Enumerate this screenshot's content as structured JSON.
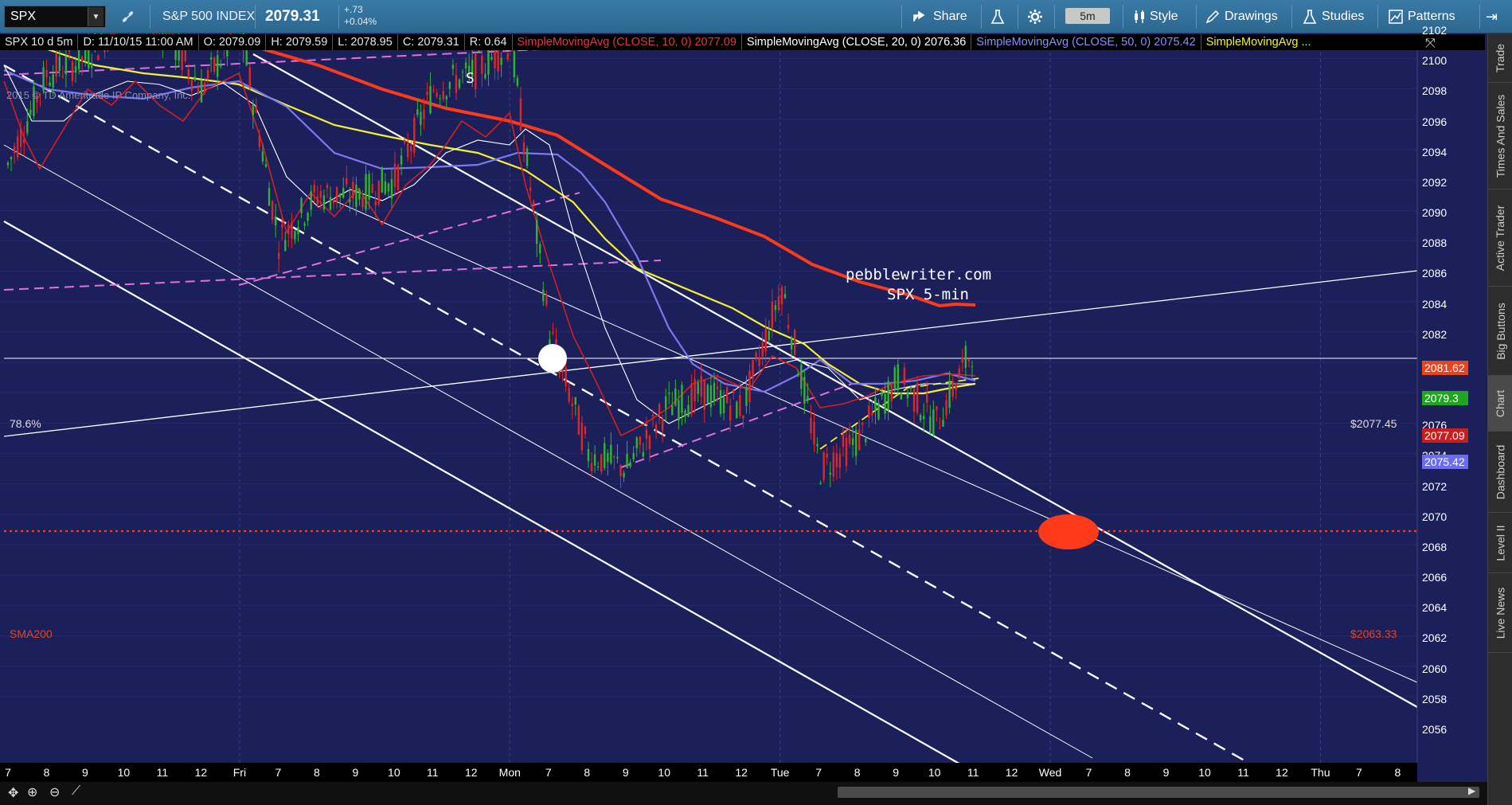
{
  "toolbar": {
    "symbol": "SPX",
    "instrument_name": "S&P 500 INDEX",
    "last_price": "2079.31",
    "change": "+.73",
    "change_pct": "+0.04%",
    "share_label": "Share",
    "timeframe": "5m",
    "style_label": "Style",
    "drawings_label": "Drawings",
    "studies_label": "Studies",
    "patterns_label": "Patterns"
  },
  "header": {
    "symbol_period": "SPX 10 d 5m",
    "date": "D: 11/10/15 11:00 AM",
    "open": "O: 2079.09",
    "high": "H: 2079.59",
    "low": "L: 2078.95",
    "close": "C: 2079.31",
    "range": "R: 0.64",
    "sma10_label": "SimpleMovingAvg (CLOSE, 10, 0)",
    "sma10_value": "2077.09",
    "sma20_label": "SimpleMovingAvg (CLOSE, 20, 0)",
    "sma20_value": "2076.36",
    "sma50_label": "SimpleMovingAvg (CLOSE, 50, 0)",
    "sma50_value": "2075.42",
    "sma100_label": "SimpleMovingAvg ..."
  },
  "chart_labels": {
    "copyright": "2015 © TD Ameritrade IP Company, Inc.",
    "marker_s": "S",
    "watermark_site": "pebblewriter.com",
    "watermark_desc": "SPX 5-min",
    "fib_label": "78.6%",
    "fib_price": "$2077.45",
    "sma200_label": "SMA200",
    "sma200_price": "$2063.33"
  },
  "price_badges": {
    "sma200": "2081.62",
    "last": "2079.3",
    "sma10": "2077.09",
    "sma50": "2075.42"
  },
  "colors": {
    "background": "#1b1f5a",
    "sma10": "#d42020",
    "sma20": "#ffffff",
    "sma50": "#7b78f0",
    "sma100": "#f2f230",
    "sma200": "#ff3a1a",
    "up_candle": "#2fb52f",
    "down_candle": "#e22626",
    "magenta_line": "#e070e0",
    "badge_green": "#1fa51f",
    "badge_red": "#c81e1e",
    "badge_blue": "#6c6cf2",
    "badge_orange": "#e8441e"
  },
  "chart_data": {
    "type": "candlestick",
    "title": "SPX 10 d 5m",
    "ylim": [
      2055,
      2103
    ],
    "y_ticks": [
      2056,
      2058,
      2060,
      2062,
      2064,
      2066,
      2068,
      2070,
      2072,
      2074,
      2076,
      2078,
      2080,
      2082,
      2084,
      2086,
      2088,
      2090,
      2092,
      2094,
      2096,
      2098,
      2100,
      2102
    ],
    "x_tick_labels": [
      "7",
      "8",
      "9",
      "10",
      "11",
      "12",
      "Fri",
      "7",
      "8",
      "9",
      "10",
      "11",
      "12",
      "Mon",
      "7",
      "8",
      "9",
      "10",
      "11",
      "12",
      "Tue",
      "7",
      "8",
      "9",
      "10",
      "11",
      "12",
      "Wed",
      "7",
      "8",
      "9",
      "10",
      "11",
      "12",
      "Thu",
      "7",
      "8"
    ],
    "close_path": [
      {
        "t": "Thu 7",
        "v": 2091
      },
      {
        "t": "Thu 8",
        "v": 2097
      },
      {
        "t": "Thu 9",
        "v": 2098
      },
      {
        "t": "Thu 10",
        "v": 2101
      },
      {
        "t": "Thu 11",
        "v": 2100
      },
      {
        "t": "Thu 12",
        "v": 2096
      },
      {
        "t": "Thu 1",
        "v": 2100
      },
      {
        "t": "Fri 7",
        "v": 2086
      },
      {
        "t": "Fri 8",
        "v": 2089
      },
      {
        "t": "Fri 9",
        "v": 2089
      },
      {
        "t": "Fri 10",
        "v": 2090
      },
      {
        "t": "Fri 11",
        "v": 2096
      },
      {
        "t": "Fri 12",
        "v": 2097
      },
      {
        "t": "Fri 1",
        "v": 2099
      },
      {
        "t": "Mon 7",
        "v": 2080
      },
      {
        "t": "Mon 8",
        "v": 2072
      },
      {
        "t": "Mon 9",
        "v": 2071
      },
      {
        "t": "Mon 10",
        "v": 2075
      },
      {
        "t": "Mon 11",
        "v": 2076
      },
      {
        "t": "Mon 12",
        "v": 2075
      },
      {
        "t": "Mon 1",
        "v": 2083
      },
      {
        "t": "Tue 7",
        "v": 2071
      },
      {
        "t": "Tue 8",
        "v": 2073
      },
      {
        "t": "Tue 9",
        "v": 2077
      },
      {
        "t": "Tue 10",
        "v": 2074
      },
      {
        "t": "Tue 11",
        "v": 2079.31
      }
    ],
    "series": [
      {
        "name": "SimpleMovingAvg (CLOSE, 10, 0)",
        "last": 2077.09
      },
      {
        "name": "SimpleMovingAvg (CLOSE, 20, 0)",
        "last": 2076.36
      },
      {
        "name": "SimpleMovingAvg (CLOSE, 50, 0)",
        "last": 2075.42
      },
      {
        "name": "SimpleMovingAvg ...",
        "last": 2075.3
      },
      {
        "name": "SMA200",
        "last": 2081.62
      }
    ],
    "horizontal_levels": [
      {
        "label": "78.6%",
        "value": 2077.45
      },
      {
        "label": "SMA200",
        "value": 2063.33
      }
    ],
    "grid": true
  }
}
